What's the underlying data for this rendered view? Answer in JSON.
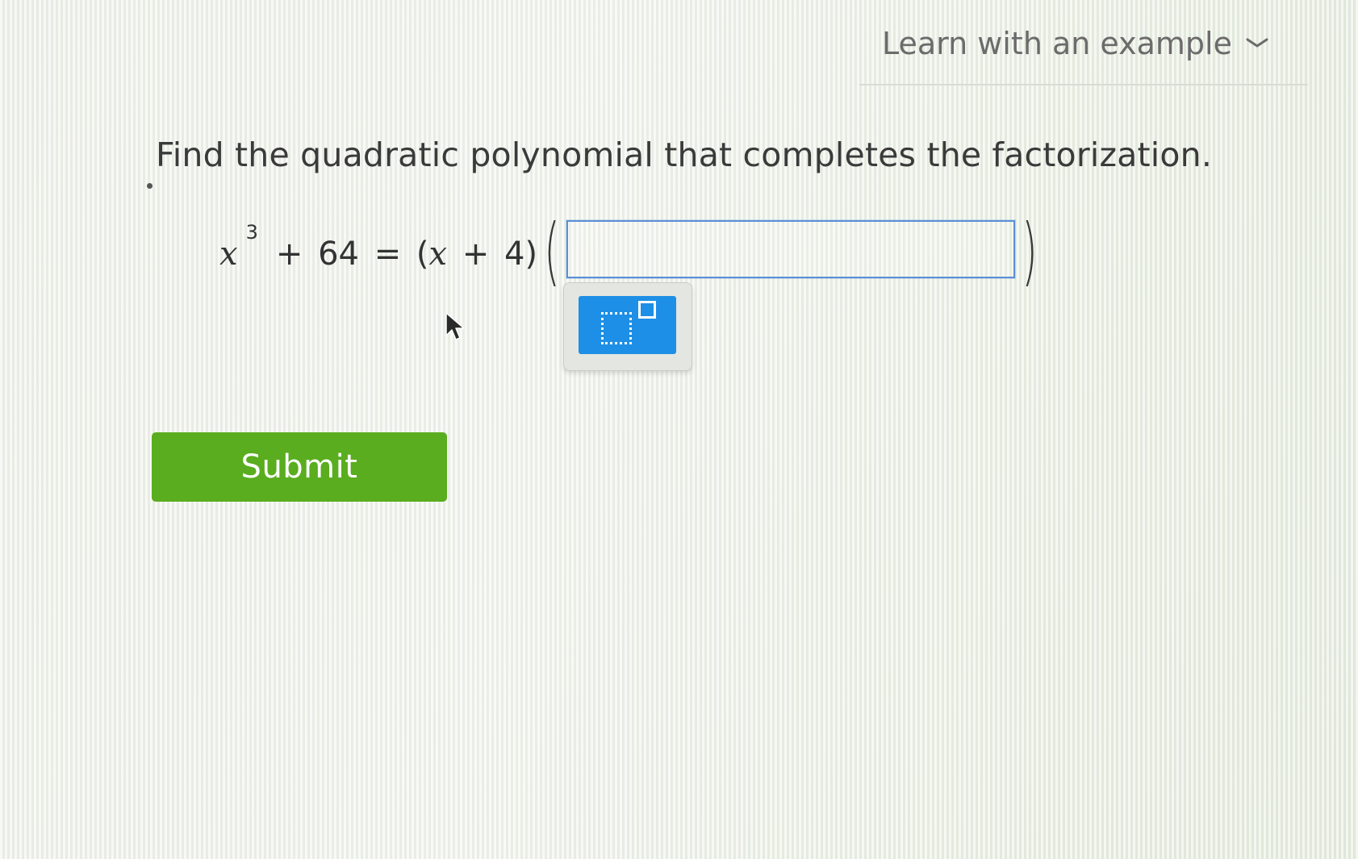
{
  "header": {
    "learn_link_label": "Learn with an example"
  },
  "question": {
    "prompt": "Find the quadratic polynomial that completes the factorization.",
    "equation": {
      "variable": "x",
      "exponent": "3",
      "rest_prefix": "+ 64 = (",
      "rest_var": "x",
      "rest_suffix": " + 4)",
      "open_paren": "(",
      "close_paren": ")"
    },
    "answer_value": ""
  },
  "palette": {
    "buttons": [
      "exponent-template"
    ]
  },
  "actions": {
    "submit_label": "Submit"
  },
  "colors": {
    "submit_green": "#59ad1e",
    "palette_button_blue": "#1e8fe6",
    "input_border_blue": "#5c8fd6",
    "link_gray": "#6b6b6b"
  },
  "icons": {
    "learn_toggle": "chevron-down-icon",
    "cursor": "mouse-pointer-icon",
    "palette_button": "exponent-template-icon"
  }
}
